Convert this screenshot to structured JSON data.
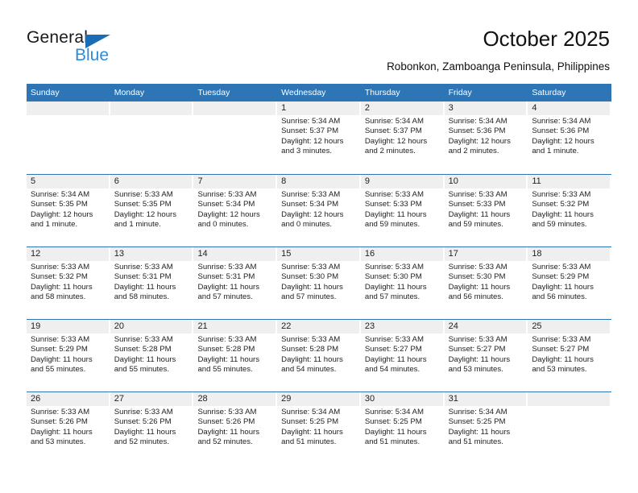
{
  "brand": {
    "name_top": "General",
    "name_bottom": "Blue",
    "triangle_icon": "blue-triangle-logo-icon",
    "accent_color": "#2e75b6",
    "logo_blue": "#2e8bd6"
  },
  "header": {
    "title": "October 2025",
    "subtitle": "Robonkon, Zamboanga Peninsula, Philippines"
  },
  "calendar": {
    "weekdays": [
      "Sunday",
      "Monday",
      "Tuesday",
      "Wednesday",
      "Thursday",
      "Friday",
      "Saturday"
    ],
    "header_bg": "#2e75b6",
    "header_text": "#ffffff",
    "daynum_bg": "#efefef",
    "weeks": [
      [
        {
          "day": ""
        },
        {
          "day": ""
        },
        {
          "day": ""
        },
        {
          "day": "1",
          "sunrise": "Sunrise: 5:34 AM",
          "sunset": "Sunset: 5:37 PM",
          "daylight_line1": "Daylight: 12 hours",
          "daylight_line2": "and 3 minutes."
        },
        {
          "day": "2",
          "sunrise": "Sunrise: 5:34 AM",
          "sunset": "Sunset: 5:37 PM",
          "daylight_line1": "Daylight: 12 hours",
          "daylight_line2": "and 2 minutes."
        },
        {
          "day": "3",
          "sunrise": "Sunrise: 5:34 AM",
          "sunset": "Sunset: 5:36 PM",
          "daylight_line1": "Daylight: 12 hours",
          "daylight_line2": "and 2 minutes."
        },
        {
          "day": "4",
          "sunrise": "Sunrise: 5:34 AM",
          "sunset": "Sunset: 5:36 PM",
          "daylight_line1": "Daylight: 12 hours",
          "daylight_line2": "and 1 minute."
        }
      ],
      [
        {
          "day": "5",
          "sunrise": "Sunrise: 5:34 AM",
          "sunset": "Sunset: 5:35 PM",
          "daylight_line1": "Daylight: 12 hours",
          "daylight_line2": "and 1 minute."
        },
        {
          "day": "6",
          "sunrise": "Sunrise: 5:33 AM",
          "sunset": "Sunset: 5:35 PM",
          "daylight_line1": "Daylight: 12 hours",
          "daylight_line2": "and 1 minute."
        },
        {
          "day": "7",
          "sunrise": "Sunrise: 5:33 AM",
          "sunset": "Sunset: 5:34 PM",
          "daylight_line1": "Daylight: 12 hours",
          "daylight_line2": "and 0 minutes."
        },
        {
          "day": "8",
          "sunrise": "Sunrise: 5:33 AM",
          "sunset": "Sunset: 5:34 PM",
          "daylight_line1": "Daylight: 12 hours",
          "daylight_line2": "and 0 minutes."
        },
        {
          "day": "9",
          "sunrise": "Sunrise: 5:33 AM",
          "sunset": "Sunset: 5:33 PM",
          "daylight_line1": "Daylight: 11 hours",
          "daylight_line2": "and 59 minutes."
        },
        {
          "day": "10",
          "sunrise": "Sunrise: 5:33 AM",
          "sunset": "Sunset: 5:33 PM",
          "daylight_line1": "Daylight: 11 hours",
          "daylight_line2": "and 59 minutes."
        },
        {
          "day": "11",
          "sunrise": "Sunrise: 5:33 AM",
          "sunset": "Sunset: 5:32 PM",
          "daylight_line1": "Daylight: 11 hours",
          "daylight_line2": "and 59 minutes."
        }
      ],
      [
        {
          "day": "12",
          "sunrise": "Sunrise: 5:33 AM",
          "sunset": "Sunset: 5:32 PM",
          "daylight_line1": "Daylight: 11 hours",
          "daylight_line2": "and 58 minutes."
        },
        {
          "day": "13",
          "sunrise": "Sunrise: 5:33 AM",
          "sunset": "Sunset: 5:31 PM",
          "daylight_line1": "Daylight: 11 hours",
          "daylight_line2": "and 58 minutes."
        },
        {
          "day": "14",
          "sunrise": "Sunrise: 5:33 AM",
          "sunset": "Sunset: 5:31 PM",
          "daylight_line1": "Daylight: 11 hours",
          "daylight_line2": "and 57 minutes."
        },
        {
          "day": "15",
          "sunrise": "Sunrise: 5:33 AM",
          "sunset": "Sunset: 5:30 PM",
          "daylight_line1": "Daylight: 11 hours",
          "daylight_line2": "and 57 minutes."
        },
        {
          "day": "16",
          "sunrise": "Sunrise: 5:33 AM",
          "sunset": "Sunset: 5:30 PM",
          "daylight_line1": "Daylight: 11 hours",
          "daylight_line2": "and 57 minutes."
        },
        {
          "day": "17",
          "sunrise": "Sunrise: 5:33 AM",
          "sunset": "Sunset: 5:30 PM",
          "daylight_line1": "Daylight: 11 hours",
          "daylight_line2": "and 56 minutes."
        },
        {
          "day": "18",
          "sunrise": "Sunrise: 5:33 AM",
          "sunset": "Sunset: 5:29 PM",
          "daylight_line1": "Daylight: 11 hours",
          "daylight_line2": "and 56 minutes."
        }
      ],
      [
        {
          "day": "19",
          "sunrise": "Sunrise: 5:33 AM",
          "sunset": "Sunset: 5:29 PM",
          "daylight_line1": "Daylight: 11 hours",
          "daylight_line2": "and 55 minutes."
        },
        {
          "day": "20",
          "sunrise": "Sunrise: 5:33 AM",
          "sunset": "Sunset: 5:28 PM",
          "daylight_line1": "Daylight: 11 hours",
          "daylight_line2": "and 55 minutes."
        },
        {
          "day": "21",
          "sunrise": "Sunrise: 5:33 AM",
          "sunset": "Sunset: 5:28 PM",
          "daylight_line1": "Daylight: 11 hours",
          "daylight_line2": "and 55 minutes."
        },
        {
          "day": "22",
          "sunrise": "Sunrise: 5:33 AM",
          "sunset": "Sunset: 5:28 PM",
          "daylight_line1": "Daylight: 11 hours",
          "daylight_line2": "and 54 minutes."
        },
        {
          "day": "23",
          "sunrise": "Sunrise: 5:33 AM",
          "sunset": "Sunset: 5:27 PM",
          "daylight_line1": "Daylight: 11 hours",
          "daylight_line2": "and 54 minutes."
        },
        {
          "day": "24",
          "sunrise": "Sunrise: 5:33 AM",
          "sunset": "Sunset: 5:27 PM",
          "daylight_line1": "Daylight: 11 hours",
          "daylight_line2": "and 53 minutes."
        },
        {
          "day": "25",
          "sunrise": "Sunrise: 5:33 AM",
          "sunset": "Sunset: 5:27 PM",
          "daylight_line1": "Daylight: 11 hours",
          "daylight_line2": "and 53 minutes."
        }
      ],
      [
        {
          "day": "26",
          "sunrise": "Sunrise: 5:33 AM",
          "sunset": "Sunset: 5:26 PM",
          "daylight_line1": "Daylight: 11 hours",
          "daylight_line2": "and 53 minutes."
        },
        {
          "day": "27",
          "sunrise": "Sunrise: 5:33 AM",
          "sunset": "Sunset: 5:26 PM",
          "daylight_line1": "Daylight: 11 hours",
          "daylight_line2": "and 52 minutes."
        },
        {
          "day": "28",
          "sunrise": "Sunrise: 5:33 AM",
          "sunset": "Sunset: 5:26 PM",
          "daylight_line1": "Daylight: 11 hours",
          "daylight_line2": "and 52 minutes."
        },
        {
          "day": "29",
          "sunrise": "Sunrise: 5:34 AM",
          "sunset": "Sunset: 5:25 PM",
          "daylight_line1": "Daylight: 11 hours",
          "daylight_line2": "and 51 minutes."
        },
        {
          "day": "30",
          "sunrise": "Sunrise: 5:34 AM",
          "sunset": "Sunset: 5:25 PM",
          "daylight_line1": "Daylight: 11 hours",
          "daylight_line2": "and 51 minutes."
        },
        {
          "day": "31",
          "sunrise": "Sunrise: 5:34 AM",
          "sunset": "Sunset: 5:25 PM",
          "daylight_line1": "Daylight: 11 hours",
          "daylight_line2": "and 51 minutes."
        },
        {
          "day": ""
        }
      ]
    ]
  }
}
